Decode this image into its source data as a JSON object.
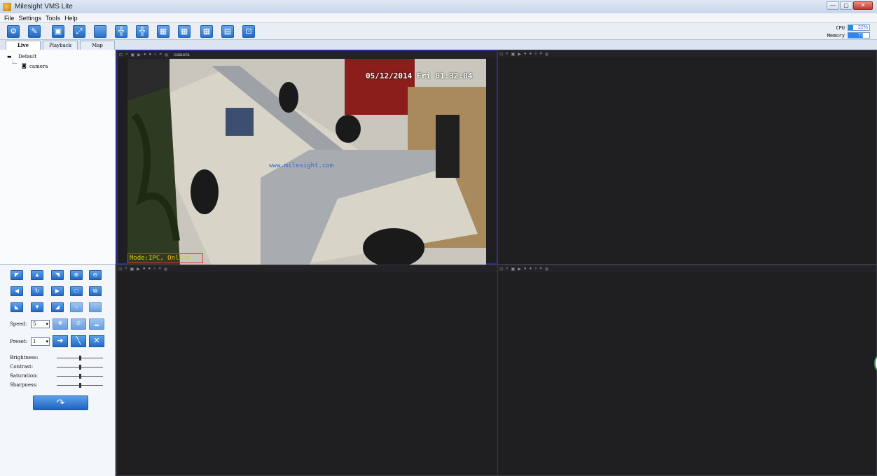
{
  "window": {
    "title": "Milesight VMS Lite",
    "controls": [
      "—",
      "▢",
      "✕"
    ]
  },
  "menu": [
    "File",
    "Settings",
    "Tools",
    "Help"
  ],
  "toolbar": {
    "icons": [
      "gear-icon",
      "brush-icon",
      "camera-icon",
      "fullscreen-icon",
      "layout-1-icon",
      "layout-4-icon",
      "layout-6-icon",
      "layout-9-icon",
      "layout-13-icon",
      "layout-16-icon",
      "layout-page-icon",
      "lock-icon"
    ],
    "glyphs": [
      "⚙",
      "✎",
      "▣",
      "⤢",
      "",
      "",
      "",
      "",
      "",
      "",
      "▤",
      "🔒"
    ]
  },
  "stats": {
    "cpu_label": "CPU",
    "cpu_value": "22%",
    "cpu_fraction": 0.22,
    "memory_label": "Memory",
    "memory_value": "71%",
    "memory_fraction": 0.71
  },
  "tabs": [
    "Live",
    "Playback",
    "Map"
  ],
  "tree": {
    "root": "Default",
    "child": "camera"
  },
  "ptz": {
    "speed_label": "Speed:",
    "speed_value": "5",
    "preset_label": "Preset:",
    "preset_value": "1",
    "brightness_label": "Brightness:",
    "contrast_label": "Contrast:",
    "saturation_label": "Saturation:",
    "sharpness_label": "Sharpness:",
    "brightness_level": 0.5,
    "contrast_level": 0.5,
    "saturation_level": 0.5,
    "sharpness_level": 0.5
  },
  "panes": [
    {
      "camera_name": "camera",
      "timestamp": "05/12/2014 Fri 01:32:04",
      "watermark": "www.milesight.com",
      "status": "Mode:IPC, Online"
    },
    {
      "camera_name": ""
    },
    {
      "camera_name": ""
    },
    {
      "camera_name": ""
    }
  ],
  "colors": {
    "accent": "#2a72cc",
    "active_border": "#2a2f8a",
    "status_text": "#e8c21a"
  }
}
